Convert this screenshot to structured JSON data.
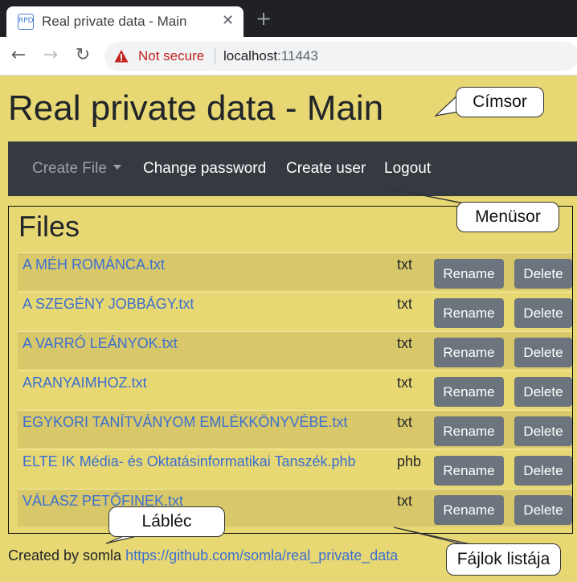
{
  "browser": {
    "tab_title": "Real private data - Main",
    "favicon_text": "RPD",
    "close_glyph": "✕",
    "new_tab_glyph": "+",
    "back_glyph": "←",
    "forward_glyph": "→",
    "reload_glyph": "↻",
    "security_label": "Not secure",
    "url_host": "localhost",
    "url_port": ":11443"
  },
  "page": {
    "title": "Real private data - Main"
  },
  "navbar": {
    "create_file": "Create File",
    "change_password": "Change password",
    "create_user": "Create user",
    "logout": "Logout"
  },
  "files": {
    "heading": "Files",
    "rename_label": "Rename",
    "delete_label": "Delete",
    "items": [
      {
        "name": "A MÉH ROMÁNCA.txt",
        "ext": "txt"
      },
      {
        "name": "A SZEGÉNY JOBBÁGY.txt",
        "ext": "txt"
      },
      {
        "name": "A VARRÓ LEÁNYOK.txt",
        "ext": "txt"
      },
      {
        "name": "ARANYAIMHOZ.txt",
        "ext": "txt"
      },
      {
        "name": "EGYKORI TANÍTVÁNYOM EMLÉKKÖNYVÉBE.txt",
        "ext": "txt"
      },
      {
        "name": "ELTE IK Média- és Oktatásinformatikai Tanszék.phb",
        "ext": "phb"
      },
      {
        "name": "VÁLASZ PETŐFINEK.txt",
        "ext": "txt"
      }
    ]
  },
  "footer": {
    "text": "Created by somla",
    "link": "https://github.com/somla/real_private_data"
  },
  "callouts": {
    "title": "Címsor",
    "menu": "Menüsor",
    "footer": "Lábléc",
    "files": "Fájlok listája"
  },
  "colors": {
    "page_bg": "#e8d874",
    "navbar_bg": "#343a40",
    "button_bg": "#6c757d",
    "link": "#3b6fd1",
    "insecure": "#c5221f"
  },
  "icons": {
    "security": "warning-triangle-icon"
  }
}
